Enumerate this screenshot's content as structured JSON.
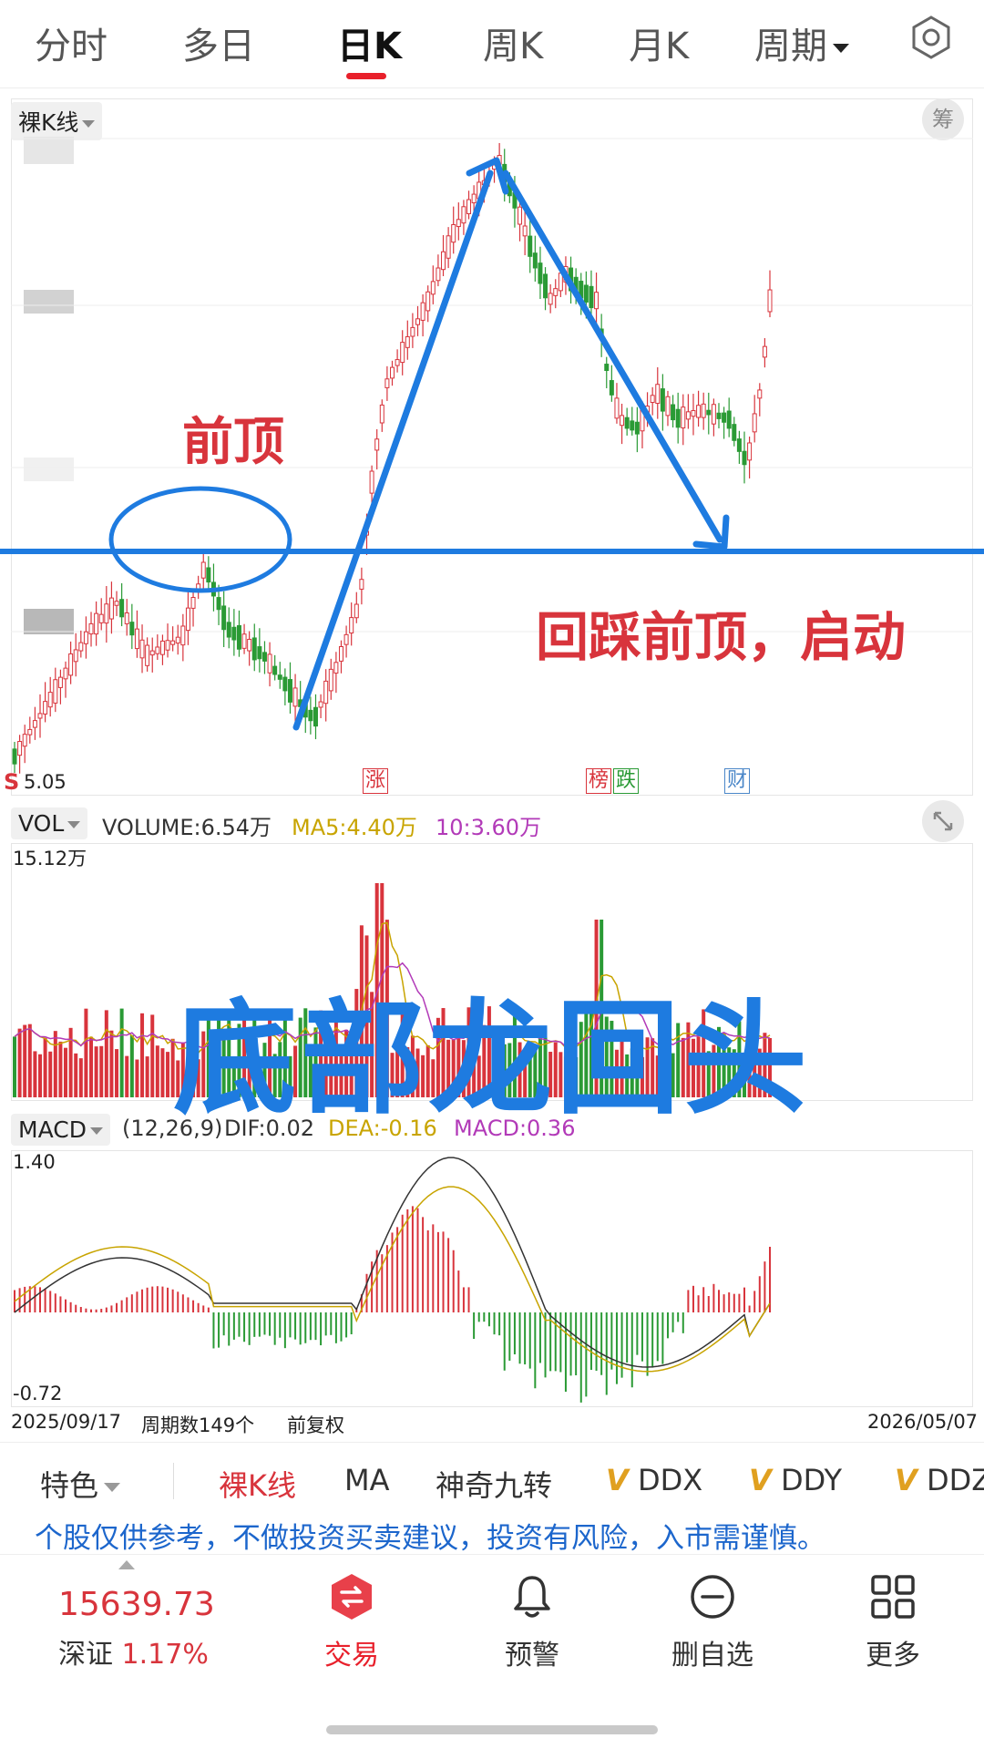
{
  "tabs": [
    {
      "label": "分时",
      "active": false
    },
    {
      "label": "多日",
      "active": false
    },
    {
      "label": "日K",
      "active": true
    },
    {
      "label": "周K",
      "active": false
    },
    {
      "label": "月K",
      "active": false
    },
    {
      "label": "周期",
      "active": false,
      "dropdown": true
    }
  ],
  "settings_icon": "gear-icon",
  "kline_panel": {
    "mode_selector": "裸K线",
    "chip_button": "筹",
    "low_price": "5.05",
    "low_marker": "S",
    "event_badges": [
      {
        "label": "涨",
        "color": "#d8343c"
      },
      {
        "label": "榜",
        "color": "#d8343c"
      },
      {
        "label": "跌",
        "color": "#2a9a35"
      },
      {
        "label": "财",
        "color": "#4a86c8"
      }
    ],
    "annotations": {
      "prev_top": "前顶",
      "pullback": "回踩前顶，启动",
      "title": "底部龙回头"
    }
  },
  "volume_panel": {
    "selector": "VOL",
    "volume": "VOLUME:6.54万",
    "ma5": "MA5:4.40万",
    "ma10": "10:3.60万",
    "max_label": "15.12万",
    "expand_icon": "expand-icon"
  },
  "macd_panel": {
    "selector": "MACD",
    "params": "(12,26,9)",
    "dif": "DIF:0.02",
    "dea": "DEA:-0.16",
    "macd": "MACD:0.36",
    "max_label": "1.40",
    "min_label": "-0.72"
  },
  "footer_info": {
    "start_date": "2025/09/17",
    "period_count": "周期数149个",
    "adjust": "前复权",
    "end_date": "2026/05/07"
  },
  "feature_bar": {
    "special": "特色",
    "items": [
      "裸K线",
      "MA",
      "神奇九转"
    ],
    "v_items": [
      "DDX",
      "DDY",
      "DDZ"
    ]
  },
  "disclaimer": "个股仅供参考，不做投资买卖建议，投资有风险，入市需谨慎。",
  "bottom_nav": {
    "index_value": "15639.73",
    "index_name": "深证",
    "index_change": "1.17%",
    "items": [
      {
        "label": "交易",
        "icon": "trade-icon"
      },
      {
        "label": "预警",
        "icon": "bell-icon"
      },
      {
        "label": "删自选",
        "icon": "minus-circle-icon"
      },
      {
        "label": "更多",
        "icon": "grid-icon"
      }
    ]
  },
  "colors": {
    "up": "#d8343c",
    "down": "#2a9a35",
    "annotation_blue": "#1e7be0",
    "annotation_red": "#d8343c",
    "ma5": "#c8a400",
    "ma10": "#b23ab8",
    "accent": "#e8202b"
  }
}
